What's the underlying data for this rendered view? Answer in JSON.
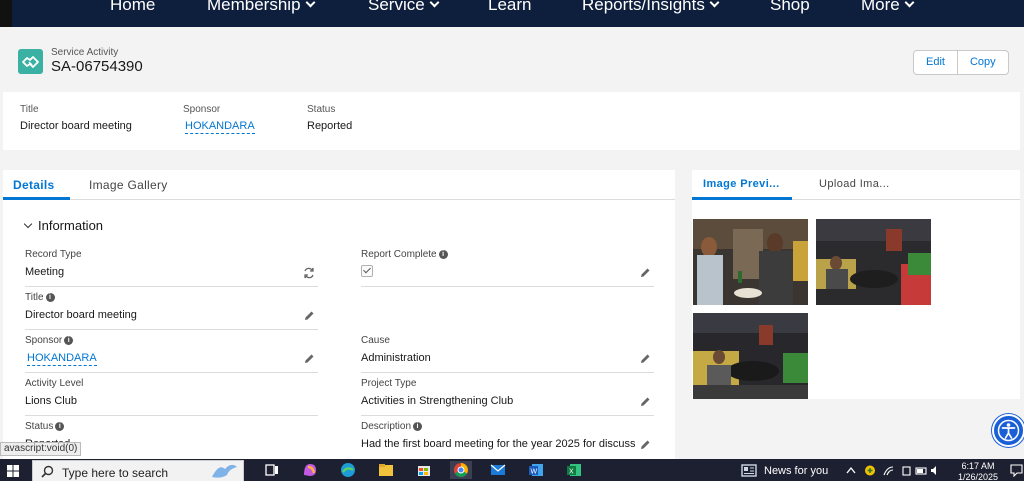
{
  "nav": {
    "items": [
      {
        "label": "Home",
        "dropdown": false
      },
      {
        "label": "Membership",
        "dropdown": true
      },
      {
        "label": "Service",
        "dropdown": true
      },
      {
        "label": "Learn",
        "dropdown": false
      },
      {
        "label": "Reports/Insights",
        "dropdown": true
      },
      {
        "label": "Shop",
        "dropdown": false
      },
      {
        "label": "More",
        "dropdown": true
      }
    ]
  },
  "header": {
    "object_label": "Service Activity",
    "record_name": "SA-06754390",
    "icon": "handshake-icon",
    "icon_color": "#3bb1a3",
    "buttons": {
      "edit": "Edit",
      "copy": "Copy"
    }
  },
  "highlights": {
    "title_label": "Title",
    "title_value": "Director board meeting",
    "sponsor_label": "Sponsor",
    "sponsor_value": "HOKANDARA",
    "status_label": "Status",
    "status_value": "Reported"
  },
  "details": {
    "tabs": [
      "Details",
      "Image Gallery"
    ],
    "active_tab": "Details",
    "section_title": "Information",
    "fields": {
      "record_type": {
        "label": "Record Type",
        "value": "Meeting"
      },
      "report_complete": {
        "label": "Report Complete",
        "checked": true
      },
      "title": {
        "label": "Title",
        "value": "Director board meeting"
      },
      "sponsor": {
        "label": "Sponsor",
        "value": "HOKANDARA"
      },
      "cause": {
        "label": "Cause",
        "value": "Administration"
      },
      "activity_level": {
        "label": "Activity Level",
        "value": "Lions Club"
      },
      "project_type": {
        "label": "Project Type",
        "value": "Activities in Strengthening Club"
      },
      "status": {
        "label": "Status",
        "value": "Reported"
      },
      "description": {
        "label": "Description",
        "value": "Had the first board meeting for the year 2025 for discuss"
      }
    }
  },
  "preview": {
    "tabs": [
      "Image Previ...",
      "Upload Ima..."
    ],
    "active_tab": "Image Previ..."
  },
  "statusbar": {
    "text": "avascript:void(0)"
  },
  "taskbar": {
    "search_placeholder": "Type here to search",
    "news": "News for you",
    "time": "6:17 AM",
    "date": "1/26/2025"
  },
  "colors": {
    "nav_bg": "#0e1f3e",
    "link": "#0176d3",
    "taskbar_bg": "#1d2030"
  }
}
